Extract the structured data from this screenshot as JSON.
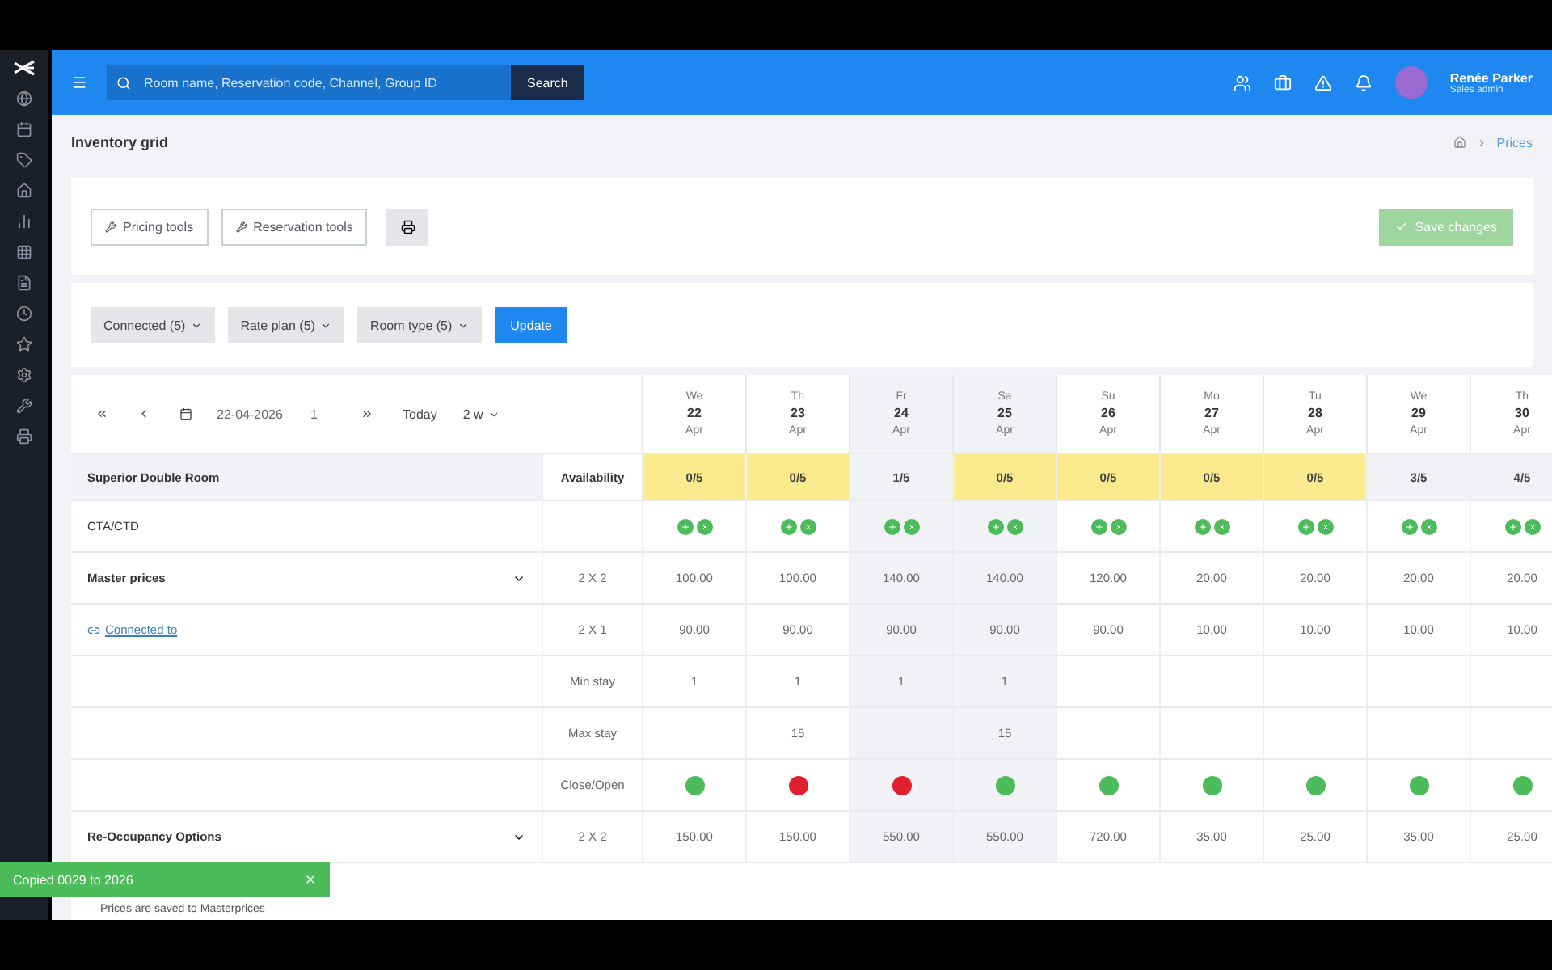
{
  "header": {
    "search_placeholder": "Room name, Reservation code, Channel, Group ID",
    "search_button": "Search",
    "user": {
      "name": "Renée Parker",
      "role": "Sales admin"
    }
  },
  "page": {
    "title": "Inventory grid",
    "breadcrumb": [
      "Prices"
    ]
  },
  "tools": [
    "Pricing tools",
    "Reservation tools"
  ],
  "save_button": {
    "label": "Save changes",
    "disabled": true
  },
  "filters": [
    "Connected (5)",
    "Rate plan (5)",
    "Room type (5)"
  ],
  "update_button": "Update",
  "date_nav": {
    "date": "22-04-2026",
    "step": "1",
    "today": "Today",
    "range": "2 w"
  },
  "days": [
    {
      "dow": "We",
      "day": "22",
      "month": "Apr",
      "weekend": false
    },
    {
      "dow": "Th",
      "day": "23",
      "month": "Apr",
      "weekend": false
    },
    {
      "dow": "Fr",
      "day": "24",
      "month": "Apr",
      "weekend": true
    },
    {
      "dow": "Sa",
      "day": "25",
      "month": "Apr",
      "weekend": true
    },
    {
      "dow": "Su",
      "day": "26",
      "month": "Apr",
      "weekend": false
    },
    {
      "dow": "Mo",
      "day": "27",
      "month": "Apr",
      "weekend": false
    },
    {
      "dow": "Tu",
      "day": "28",
      "month": "Apr",
      "weekend": false
    },
    {
      "dow": "We",
      "day": "29",
      "month": "Apr",
      "weekend": false
    },
    {
      "dow": "Th",
      "day": "30",
      "month": "Apr",
      "weekend": false
    }
  ],
  "room": {
    "name": "Superior Double Room",
    "availability_label": "Availability",
    "availability": [
      {
        "value": "0/5",
        "sold_out": true
      },
      {
        "value": "0/5",
        "sold_out": true
      },
      {
        "value": "1/5",
        "sold_out": false
      },
      {
        "value": "0/5",
        "sold_out": true
      },
      {
        "value": "0/5",
        "sold_out": true
      },
      {
        "value": "0/5",
        "sold_out": true
      },
      {
        "value": "0/5",
        "sold_out": true
      },
      {
        "value": "3/5",
        "sold_out": false
      },
      {
        "value": "4/5",
        "sold_out": false
      }
    ]
  },
  "cta_label": "CTA/CTD",
  "rate_plans": [
    {
      "name": "Master prices",
      "expanded": true,
      "link": "Connected to",
      "rows": [
        {
          "kind": "price",
          "label": "2 X 2",
          "values": [
            "100.00",
            "100.00",
            "140.00",
            "140.00",
            "120.00",
            "20.00",
            "20.00",
            "20.00",
            "20.00"
          ]
        },
        {
          "kind": "price",
          "label": "2 X 1",
          "values": [
            "90.00",
            "90.00",
            "90.00",
            "90.00",
            "90.00",
            "10.00",
            "10.00",
            "10.00",
            "10.00"
          ]
        },
        {
          "kind": "stay",
          "label": "Min stay",
          "cells": [
            {
              "value": "1"
            },
            {
              "value": "1"
            },
            {
              "value": "1"
            },
            {
              "value": "1"
            },
            {},
            {},
            {},
            {},
            {}
          ]
        },
        {
          "kind": "stay",
          "label": "Max stay",
          "cells": [
            {},
            {
              "value": "15"
            },
            {},
            {
              "value": "15"
            },
            {},
            {},
            {},
            {},
            {}
          ]
        },
        {
          "kind": "status",
          "label": "Close/Open",
          "values": [
            true,
            false,
            false,
            true,
            true,
            true,
            true,
            true,
            true
          ]
        }
      ]
    },
    {
      "name": "Re-Occupancy Options",
      "expanded": true,
      "note": "Prices are saved to Masterprices",
      "rows": [
        {
          "kind": "price",
          "label": "2 X 2",
          "values": [
            "150.00",
            "150.00",
            "550.00",
            "550.00",
            "720.00",
            "35.00",
            "25.00",
            "35.00",
            "25.00"
          ]
        }
      ]
    }
  ],
  "toast": {
    "text": "Copied 0029 to 2026"
  }
}
